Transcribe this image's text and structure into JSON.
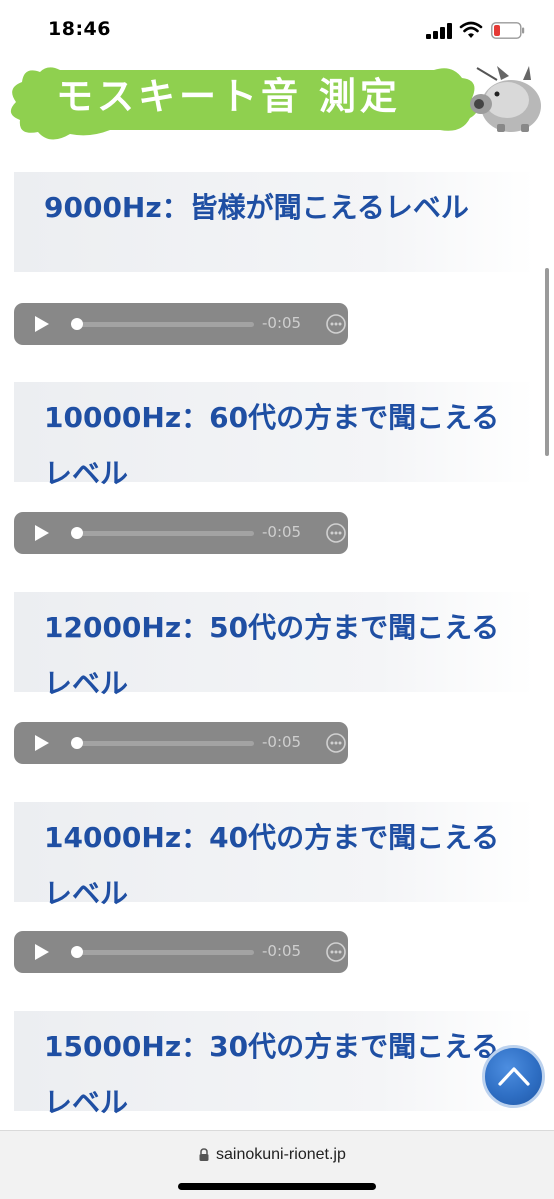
{
  "status_bar": {
    "time": "18:46"
  },
  "banner": {
    "title": "モスキート音 測定"
  },
  "sections": [
    {
      "title": "9000Hz：皆様が聞こえるレベル",
      "audio_time": "-0:05"
    },
    {
      "title": "10000Hz：60代の方まで聞こえるレベル",
      "audio_time": "-0:05"
    },
    {
      "title": "12000Hz：50代の方まで聞こえるレベル",
      "audio_time": "-0:05"
    },
    {
      "title": "14000Hz：40代の方まで聞こえるレベル",
      "audio_time": "-0:05"
    },
    {
      "title": "15000Hz：30代の方まで聞こえるレベル"
    }
  ],
  "browser": {
    "url": "sainokuni-rionet.jp"
  },
  "colors": {
    "heading_text": "#1f4fa3",
    "banner_green": "#8fd04f",
    "back_to_top": "#2f6fc4",
    "audio_player": "#888888"
  },
  "icons": [
    "signal-icon",
    "wifi-icon",
    "battery-icon",
    "play-icon",
    "more-icon",
    "chevron-up-icon",
    "lock-icon"
  ]
}
